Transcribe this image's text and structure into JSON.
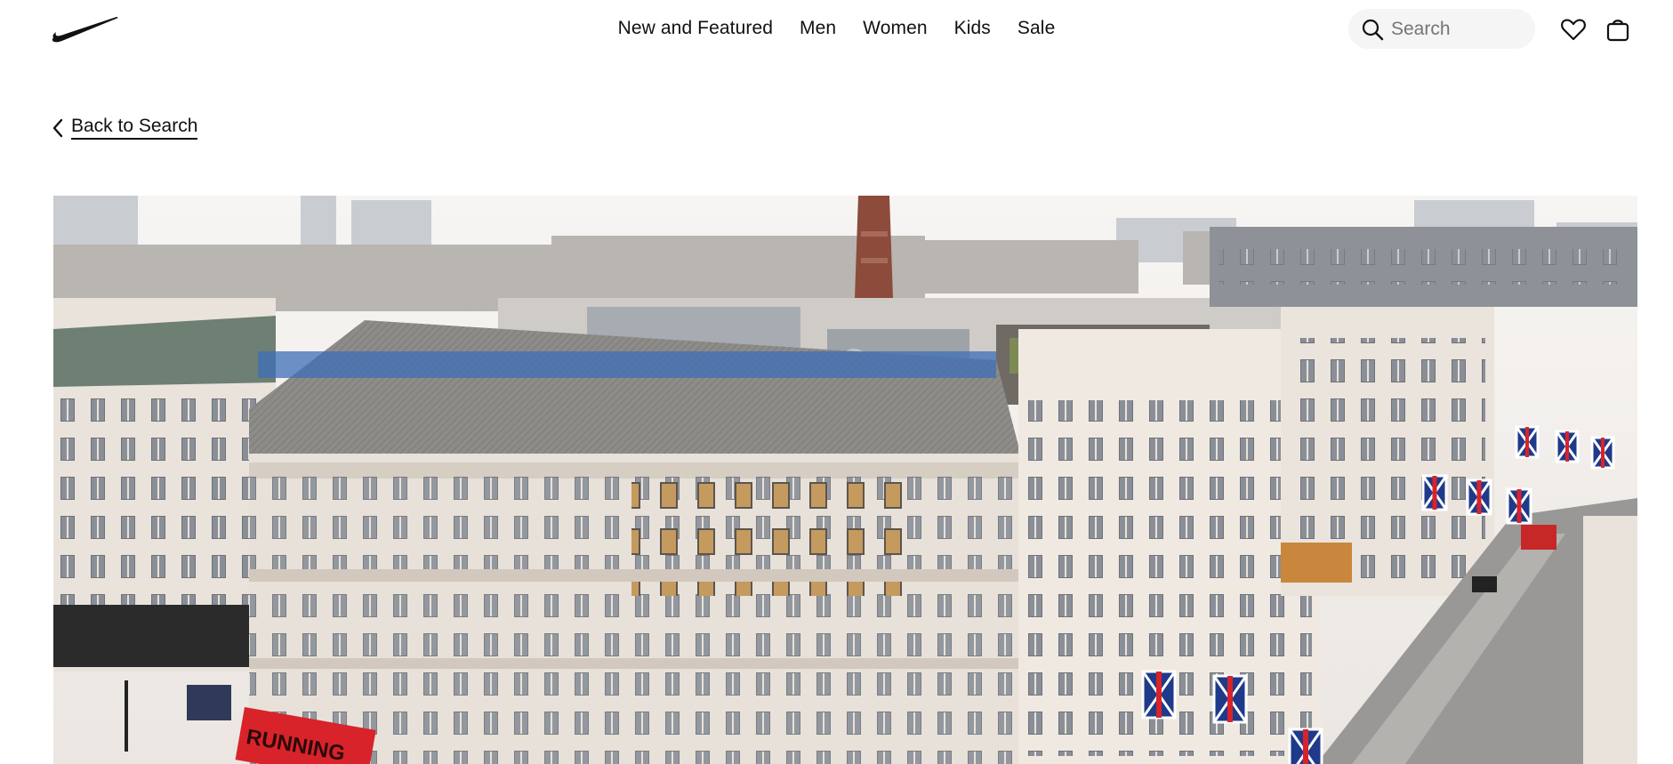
{
  "brand": {
    "logo_icon": "swoosh-logo"
  },
  "nav": {
    "items": [
      {
        "label": "New and Featured"
      },
      {
        "label": "Men"
      },
      {
        "label": "Women"
      },
      {
        "label": "Kids"
      },
      {
        "label": "Sale"
      }
    ]
  },
  "search": {
    "placeholder": "Search",
    "icon": "search-icon"
  },
  "header_icons": {
    "favorites": "heart-icon",
    "bag": "bag-icon"
  },
  "back": {
    "label": "Back to Search",
    "icon": "chevron-left-icon"
  },
  "hero": {
    "description_icon": "store-photo",
    "store_sign": "RUNNING",
    "colors": {
      "sky": "#f4f1ee",
      "stone": "#e6ded6",
      "roof": "#8c8a87",
      "red_sign": "#d8232a",
      "flag_blue": "#1f3a8a"
    }
  }
}
